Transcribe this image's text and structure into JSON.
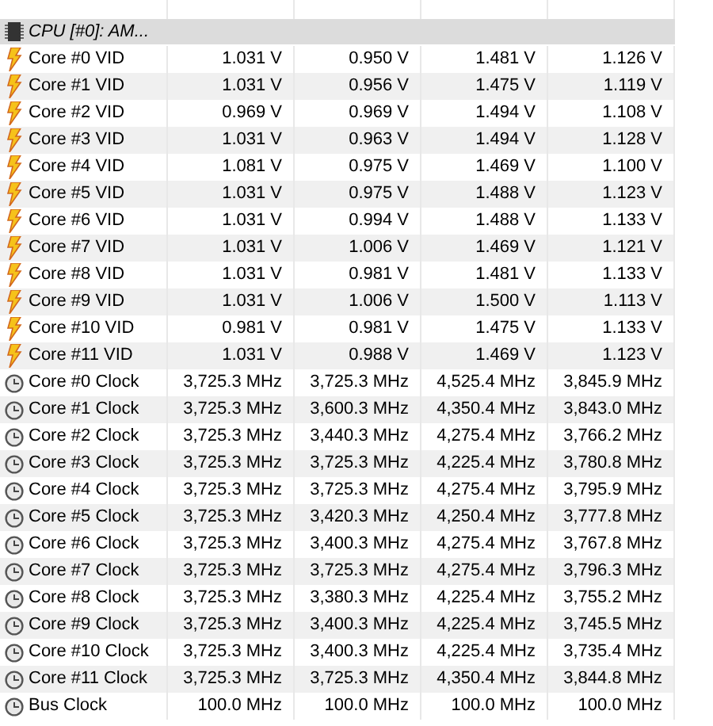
{
  "group": {
    "label": "CPU [#0]: AM...",
    "kind": "cpu"
  },
  "rows": [
    {
      "kind": "voltage",
      "label": "Core #0 VID",
      "values": [
        "1.031 V",
        "0.950 V",
        "1.481 V",
        "1.126 V"
      ]
    },
    {
      "kind": "voltage",
      "label": "Core #1 VID",
      "values": [
        "1.031 V",
        "0.956 V",
        "1.475 V",
        "1.119 V"
      ]
    },
    {
      "kind": "voltage",
      "label": "Core #2 VID",
      "values": [
        "0.969 V",
        "0.969 V",
        "1.494 V",
        "1.108 V"
      ]
    },
    {
      "kind": "voltage",
      "label": "Core #3 VID",
      "values": [
        "1.031 V",
        "0.963 V",
        "1.494 V",
        "1.128 V"
      ]
    },
    {
      "kind": "voltage",
      "label": "Core #4 VID",
      "values": [
        "1.081 V",
        "0.975 V",
        "1.469 V",
        "1.100 V"
      ]
    },
    {
      "kind": "voltage",
      "label": "Core #5 VID",
      "values": [
        "1.031 V",
        "0.975 V",
        "1.488 V",
        "1.123 V"
      ]
    },
    {
      "kind": "voltage",
      "label": "Core #6 VID",
      "values": [
        "1.031 V",
        "0.994 V",
        "1.488 V",
        "1.133 V"
      ]
    },
    {
      "kind": "voltage",
      "label": "Core #7 VID",
      "values": [
        "1.031 V",
        "1.006 V",
        "1.469 V",
        "1.121 V"
      ]
    },
    {
      "kind": "voltage",
      "label": "Core #8 VID",
      "values": [
        "1.031 V",
        "0.981 V",
        "1.481 V",
        "1.133 V"
      ]
    },
    {
      "kind": "voltage",
      "label": "Core #9 VID",
      "values": [
        "1.031 V",
        "1.006 V",
        "1.500 V",
        "1.113 V"
      ]
    },
    {
      "kind": "voltage",
      "label": "Core #10 VID",
      "values": [
        "0.981 V",
        "0.981 V",
        "1.475 V",
        "1.133 V"
      ]
    },
    {
      "kind": "voltage",
      "label": "Core #11 VID",
      "values": [
        "1.031 V",
        "0.988 V",
        "1.469 V",
        "1.123 V"
      ]
    },
    {
      "kind": "clock",
      "label": "Core #0 Clock",
      "values": [
        "3,725.3 MHz",
        "3,725.3 MHz",
        "4,525.4 MHz",
        "3,845.9 MHz"
      ]
    },
    {
      "kind": "clock",
      "label": "Core #1 Clock",
      "values": [
        "3,725.3 MHz",
        "3,600.3 MHz",
        "4,350.4 MHz",
        "3,843.0 MHz"
      ]
    },
    {
      "kind": "clock",
      "label": "Core #2 Clock",
      "values": [
        "3,725.3 MHz",
        "3,440.3 MHz",
        "4,275.4 MHz",
        "3,766.2 MHz"
      ]
    },
    {
      "kind": "clock",
      "label": "Core #3 Clock",
      "values": [
        "3,725.3 MHz",
        "3,725.3 MHz",
        "4,225.4 MHz",
        "3,780.8 MHz"
      ]
    },
    {
      "kind": "clock",
      "label": "Core #4 Clock",
      "values": [
        "3,725.3 MHz",
        "3,725.3 MHz",
        "4,275.4 MHz",
        "3,795.9 MHz"
      ]
    },
    {
      "kind": "clock",
      "label": "Core #5 Clock",
      "values": [
        "3,725.3 MHz",
        "3,420.3 MHz",
        "4,250.4 MHz",
        "3,777.8 MHz"
      ]
    },
    {
      "kind": "clock",
      "label": "Core #6 Clock",
      "values": [
        "3,725.3 MHz",
        "3,400.3 MHz",
        "4,275.4 MHz",
        "3,767.8 MHz"
      ]
    },
    {
      "kind": "clock",
      "label": "Core #7 Clock",
      "values": [
        "3,725.3 MHz",
        "3,725.3 MHz",
        "4,275.4 MHz",
        "3,796.3 MHz"
      ]
    },
    {
      "kind": "clock",
      "label": "Core #8 Clock",
      "values": [
        "3,725.3 MHz",
        "3,380.3 MHz",
        "4,225.4 MHz",
        "3,755.2 MHz"
      ]
    },
    {
      "kind": "clock",
      "label": "Core #9 Clock",
      "values": [
        "3,725.3 MHz",
        "3,400.3 MHz",
        "4,225.4 MHz",
        "3,745.5 MHz"
      ]
    },
    {
      "kind": "clock",
      "label": "Core #10 Clock",
      "values": [
        "3,725.3 MHz",
        "3,400.3 MHz",
        "4,225.4 MHz",
        "3,735.4 MHz"
      ]
    },
    {
      "kind": "clock",
      "label": "Core #11 Clock",
      "values": [
        "3,725.3 MHz",
        "3,725.3 MHz",
        "4,350.4 MHz",
        "3,844.8 MHz"
      ]
    },
    {
      "kind": "clock",
      "label": "Bus Clock",
      "values": [
        "100.0 MHz",
        "100.0 MHz",
        "100.0 MHz",
        "100.0 MHz"
      ]
    }
  ]
}
